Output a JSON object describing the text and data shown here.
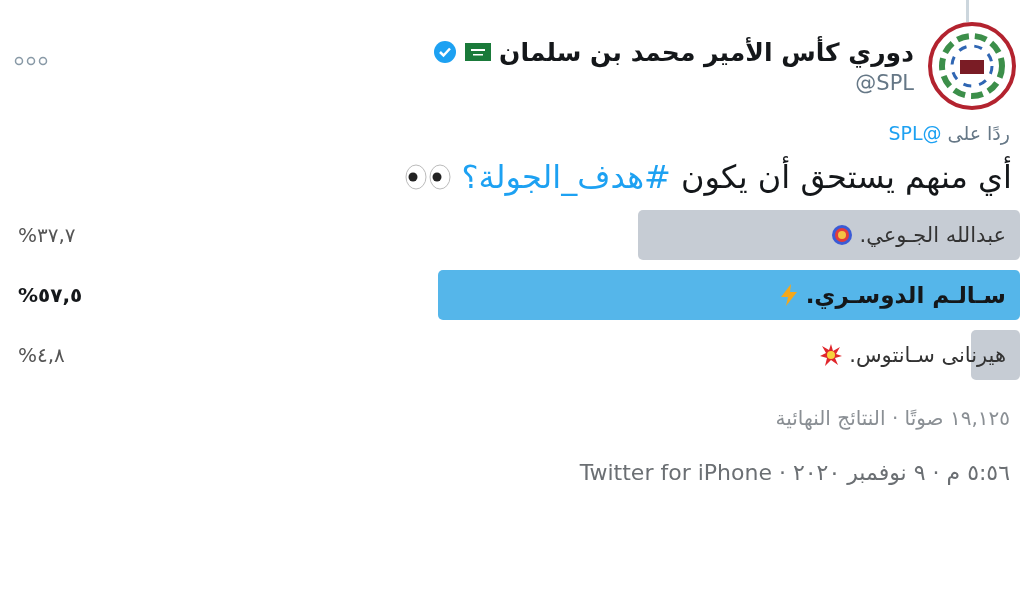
{
  "author": {
    "name": "دوري كأس الأمير محمد بن سلمان",
    "handle": "@SPL",
    "verified": true
  },
  "reply_to": {
    "prefix": "ردًا على",
    "handle": "@SPL"
  },
  "tweet": {
    "text": "أي منهم يستحق أن يكون ",
    "hashtag": "#هدف_الجولة؟"
  },
  "poll": {
    "options": [
      {
        "label": "عبدالله الجـوعي.",
        "level": 0.377,
        "percent": "%٣٧,٧",
        "selected": false
      },
      {
        "label": "سـالـم الدوسـري.",
        "level": 0.575,
        "percent": "%٥٧,٥",
        "selected": true
      },
      {
        "label": "هيرنانى سـانتوس.",
        "level": 0.048,
        "percent": "%٤,٨",
        "selected": false
      }
    ],
    "summary": "١٩,١٢٥ صوتًا · النتائج النهائية"
  },
  "meta": "٥:٥٦ م · ٩ نوفمبر ٢٠٢٠ · Twitter for iPhone"
}
